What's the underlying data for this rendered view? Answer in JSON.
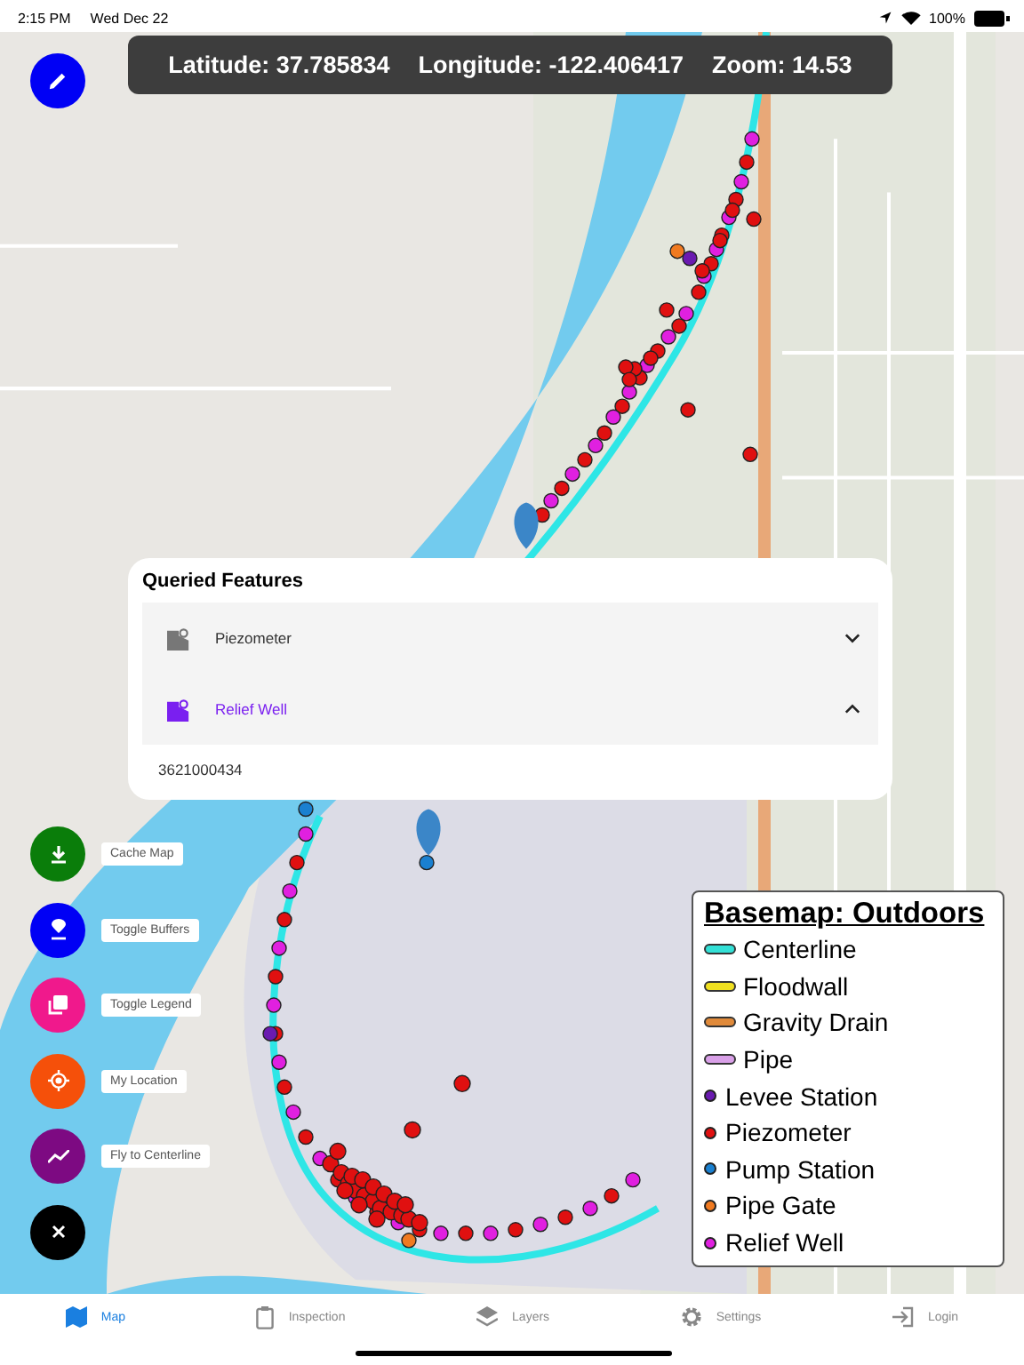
{
  "status_bar": {
    "time": "2:15 PM",
    "date": "Wed Dec 22",
    "battery": "100%"
  },
  "coordinates_bar": {
    "latitude": "Latitude: 37.785834",
    "longitude": "Longitude: -122.406417",
    "zoom": "Zoom: 14.53"
  },
  "queried_features": {
    "title": "Queried Features",
    "items": [
      {
        "label": "Piezometer",
        "expanded": false
      },
      {
        "label": "Relief Well",
        "expanded": true,
        "value": "3621000434"
      }
    ]
  },
  "action_buttons": [
    {
      "kind": "download",
      "label": "Cache Map",
      "color": "#0a7d0a"
    },
    {
      "kind": "pin",
      "label": "Toggle Buffers",
      "color": "#0000f5"
    },
    {
      "kind": "layers",
      "label": "Toggle Legend",
      "color": "#f0198c"
    },
    {
      "kind": "target",
      "label": "My Location",
      "color": "#f5500a"
    },
    {
      "kind": "trend",
      "label": "Fly to Centerline",
      "color": "#7d0a82"
    },
    {
      "kind": "close",
      "color": "#000000"
    }
  ],
  "legend": {
    "title": "Basemap: Outdoors",
    "items": [
      {
        "kind": "line",
        "label": "Centerline",
        "color": "#33e0d6"
      },
      {
        "kind": "line",
        "label": "Floodwall",
        "color": "#f0e020"
      },
      {
        "kind": "line",
        "label": "Gravity Drain",
        "color": "#e08a3a"
      },
      {
        "kind": "line",
        "label": "Pipe",
        "color": "#d9a0e8"
      },
      {
        "kind": "dot",
        "label": "Levee Station",
        "color": "#6a1ab0"
      },
      {
        "kind": "dot",
        "label": "Piezometer",
        "color": "#e01010"
      },
      {
        "kind": "dot",
        "label": "Pump Station",
        "color": "#1a80d0"
      },
      {
        "kind": "dot",
        "label": "Pipe Gate",
        "color": "#f07a20"
      },
      {
        "kind": "dot",
        "label": "Relief Well",
        "color": "#e020e0"
      }
    ]
  },
  "tabs": [
    {
      "kind": "map",
      "label": "Map",
      "selected": true
    },
    {
      "kind": "clipboard",
      "label": "Inspection",
      "selected": false
    },
    {
      "kind": "layers",
      "label": "Layers",
      "selected": false
    },
    {
      "kind": "gear",
      "label": "Settings",
      "selected": false
    },
    {
      "kind": "login",
      "label": "Login",
      "selected": false
    }
  ]
}
